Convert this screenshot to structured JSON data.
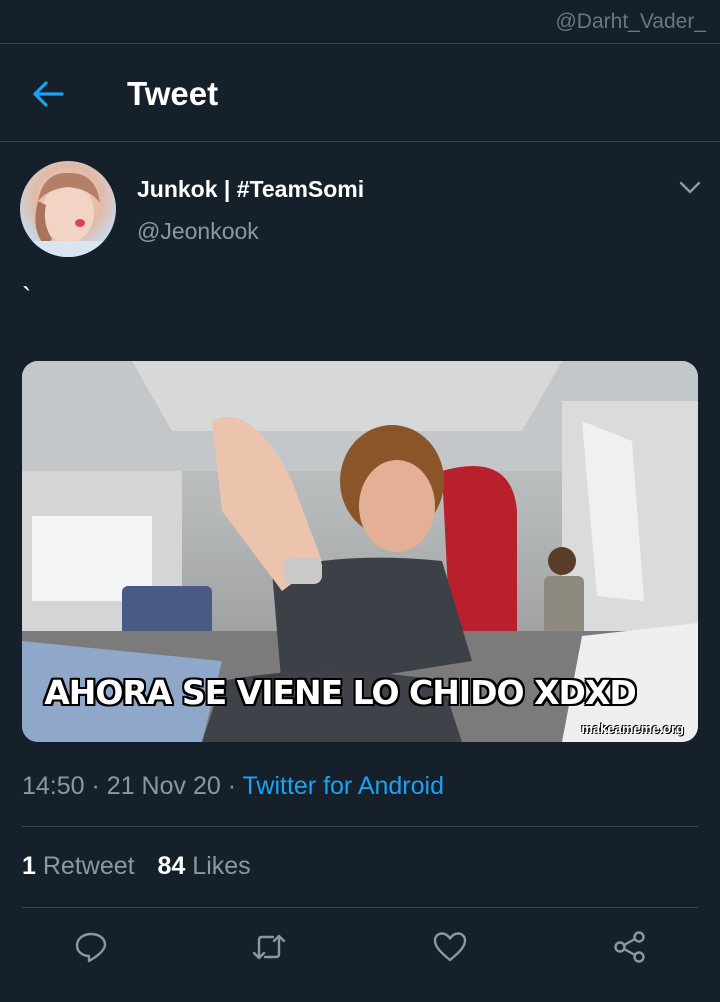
{
  "topbar": {
    "watermark": "@Darht_Vader_"
  },
  "header": {
    "title": "Tweet"
  },
  "tweet": {
    "author": {
      "display_name": "Junkok | #TeamSomi",
      "handle": "@Jeonkook"
    },
    "text": "`",
    "media": {
      "caption": "AHORA SE VIENE LO CHIDO XDXD",
      "watermark": "makeameme.org"
    },
    "time": "14:50",
    "sep1": " · ",
    "date": "21 Nov 20",
    "sep2": " · ",
    "source": "Twitter for Android",
    "retweets": {
      "count": "1",
      "label": "Retweet"
    },
    "likes": {
      "count": "84",
      "label": "Likes"
    }
  },
  "colors": {
    "background": "#15202b",
    "accent": "#1da1f2",
    "muted": "#8899a6",
    "divider": "#38444d"
  },
  "icons": [
    "back-arrow-icon",
    "chevron-down-icon",
    "reply-icon",
    "retweet-icon",
    "like-icon",
    "share-icon"
  ]
}
